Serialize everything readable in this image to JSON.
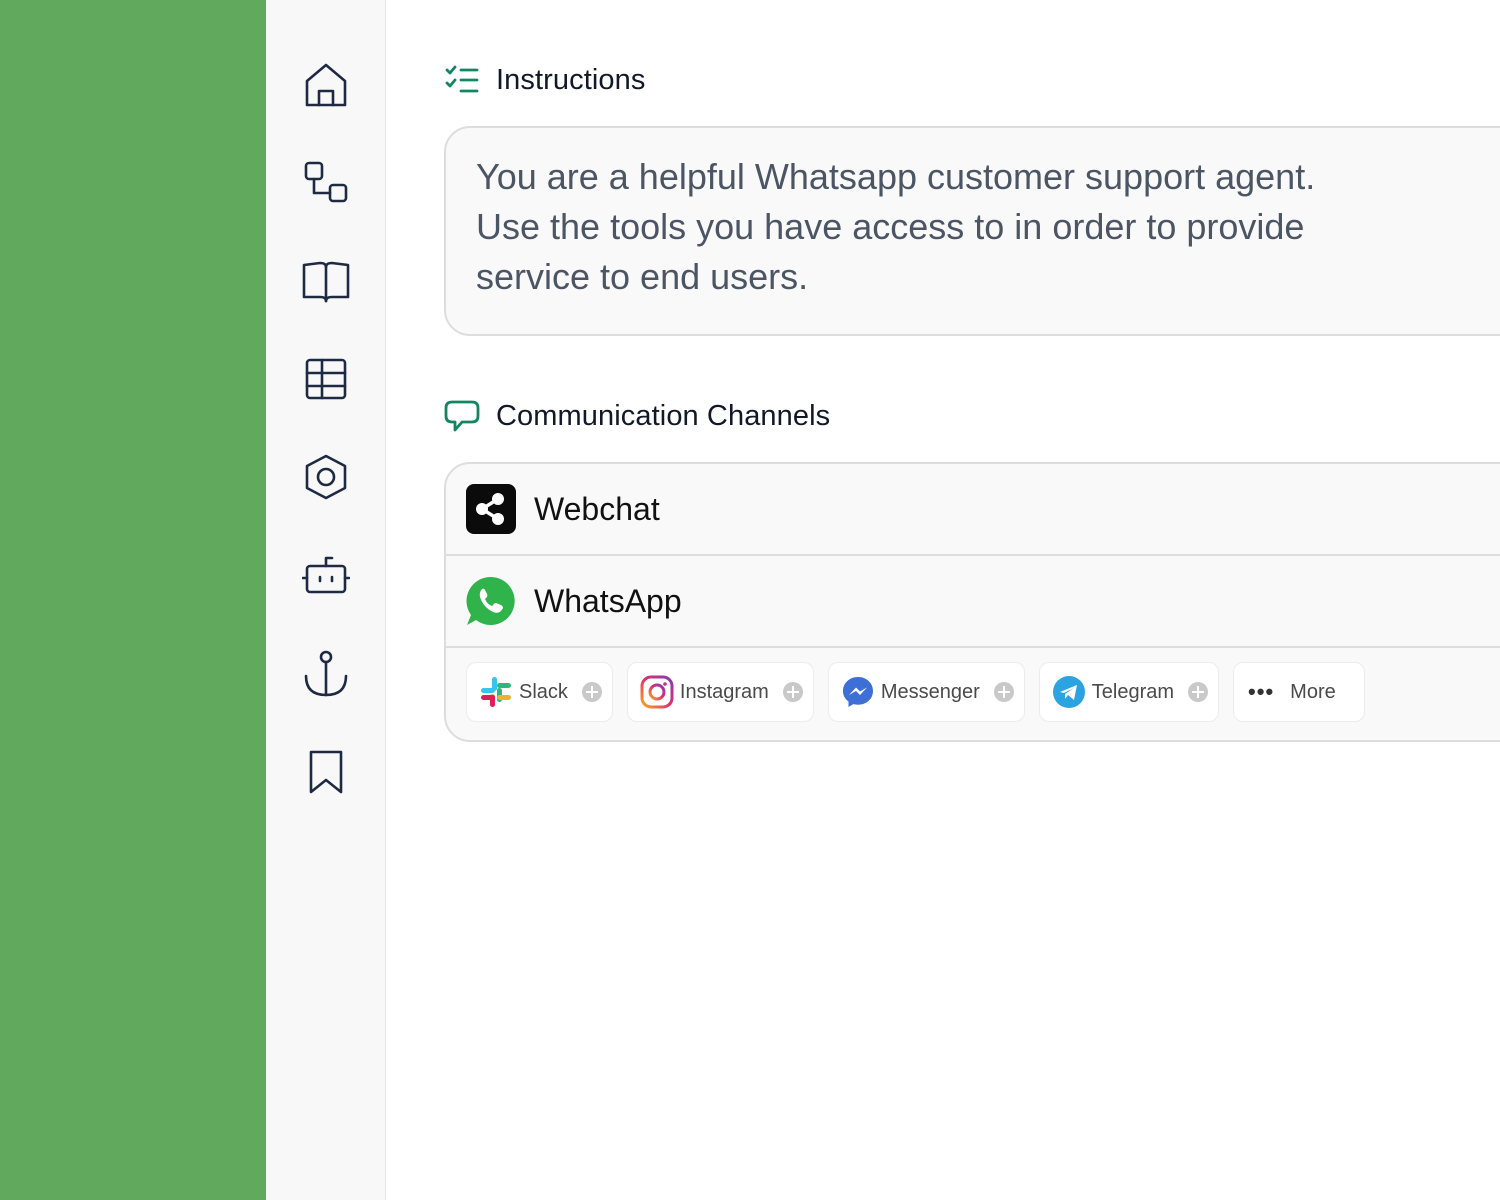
{
  "sidebar": {
    "items": [
      {
        "icon": "home-icon"
      },
      {
        "icon": "workflow-icon"
      },
      {
        "icon": "book-icon"
      },
      {
        "icon": "table-icon"
      },
      {
        "icon": "hexagon-settings-icon"
      },
      {
        "icon": "bot-icon"
      },
      {
        "icon": "anchor-icon"
      },
      {
        "icon": "bookmark-icon"
      }
    ]
  },
  "instructions": {
    "title": "Instructions",
    "icon": "checklist-icon",
    "text": "You are a helpful Whatsapp customer support agent. Use the tools you have access to in order to provide service to end users."
  },
  "channels": {
    "title": "Communication Channels",
    "icon": "chat-bubble-icon",
    "active": [
      {
        "name": "Webchat",
        "icon": "webchat-share-icon"
      },
      {
        "name": "WhatsApp",
        "icon": "whatsapp-icon"
      }
    ],
    "available": [
      {
        "name": "Slack",
        "icon": "slack-icon"
      },
      {
        "name": "Instagram",
        "icon": "instagram-icon"
      },
      {
        "name": "Messenger",
        "icon": "messenger-icon"
      },
      {
        "name": "Telegram",
        "icon": "telegram-icon"
      }
    ],
    "more_label": "More"
  },
  "colors": {
    "left_panel": "#61aa5d",
    "accent": "#12865e",
    "whatsapp": "#2fb34a"
  }
}
